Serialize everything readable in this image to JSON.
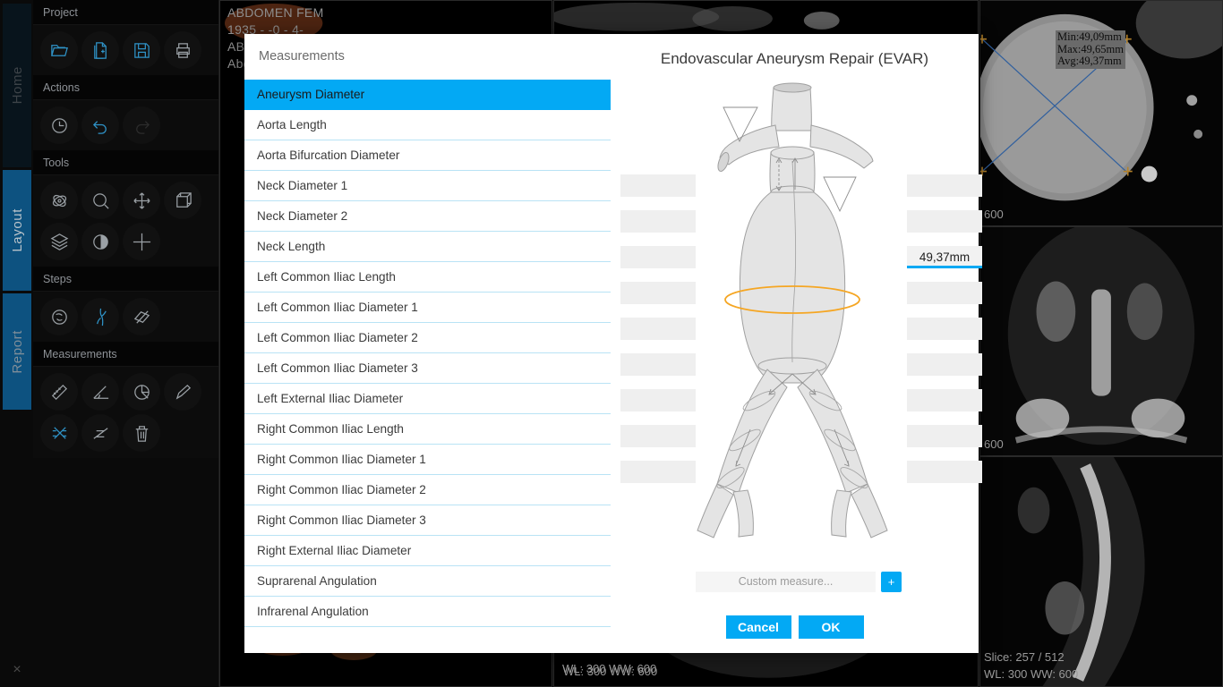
{
  "sidebar": {
    "vertical_tabs": [
      {
        "label": "Home",
        "active": false
      },
      {
        "label": "Layout",
        "active": true
      },
      {
        "label": "Report",
        "active": false
      }
    ],
    "close_icon": "×",
    "groups": [
      {
        "title": "Project",
        "tools": [
          "open-folder-icon",
          "new-document-icon",
          "save-icon",
          "print-icon"
        ]
      },
      {
        "title": "Actions",
        "tools": [
          "history-clock-icon",
          "undo-icon",
          "redo-icon"
        ]
      },
      {
        "title": "Tools",
        "tools": [
          "rotate-3d-icon",
          "zoom-magnifier-icon",
          "pan-move-icon",
          "crop-box-icon",
          "layers-icon",
          "contrast-icon",
          "crosshair-icon"
        ]
      },
      {
        "title": "Steps",
        "tools": [
          "centerline-seed-icon",
          "vessel-tree-icon",
          "slab-plane-icon"
        ]
      },
      {
        "title": "Measurements",
        "tools": [
          "ruler-icon",
          "angle-icon",
          "pie-area-icon",
          "pencil-icon",
          "cross-marker-icon",
          "polyline-icon",
          "trash-icon"
        ]
      }
    ]
  },
  "viewports": {
    "main": {
      "patient_name": "ABDOMEN FEM",
      "patient_id": "1935 - -0 - 4-",
      "study_line1": "ABD",
      "study_line2": "Abd",
      "wl_ww": "WL: 300  WW: 600"
    },
    "axial_top": {
      "wl_ww": "WL: 300  WW: 600"
    },
    "right_top": {
      "callout_min": "Min:49,09mm",
      "callout_max": "Max:49,65mm",
      "callout_avg": "Avg:49,37mm",
      "ww_partial": "600"
    },
    "right_mid": {
      "ww_partial": "600"
    },
    "right_bottom": {
      "slice": "Slice: 257 / 512",
      "wl_ww": "WL: 300  WW: 600"
    }
  },
  "modal": {
    "left_title": "Measurements",
    "title": "Endovascular Aneurysm Repair (EVAR)",
    "measurements": [
      {
        "label": "Aneurysm Diameter",
        "selected": true
      },
      {
        "label": "Aorta Length",
        "selected": false
      },
      {
        "label": "Aorta Bifurcation Diameter",
        "selected": false
      },
      {
        "label": "Neck Diameter 1",
        "selected": false
      },
      {
        "label": "Neck Diameter 2",
        "selected": false
      },
      {
        "label": "Neck Length",
        "selected": false
      },
      {
        "label": "Left Common Iliac Length",
        "selected": false
      },
      {
        "label": "Left Common Iliac Diameter 1",
        "selected": false
      },
      {
        "label": "Left Common Iliac Diameter 2",
        "selected": false
      },
      {
        "label": "Left Common Iliac Diameter 3",
        "selected": false
      },
      {
        "label": "Left External Iliac Diameter",
        "selected": false
      },
      {
        "label": "Right Common Iliac Length",
        "selected": false
      },
      {
        "label": "Right Common Iliac Diameter 1",
        "selected": false
      },
      {
        "label": "Right Common Iliac Diameter 2",
        "selected": false
      },
      {
        "label": "Right Common Iliac Diameter 3",
        "selected": false
      },
      {
        "label": "Right External Iliac Diameter",
        "selected": false
      },
      {
        "label": "Suprarenal Angulation",
        "selected": false
      },
      {
        "label": "Infrarenal Angulation",
        "selected": false
      }
    ],
    "fields_left": [
      "",
      "",
      "",
      "",
      "",
      "",
      "",
      "",
      ""
    ],
    "fields_right": [
      "",
      "",
      "49,37mm",
      "",
      "",
      "",
      "",
      "",
      ""
    ],
    "active_field_index": 2,
    "custom_measure_placeholder": "Custom measure...",
    "add_button_label": "+",
    "cancel_label": "Cancel",
    "ok_label": "OK"
  },
  "colors": {
    "accent": "#03a9f4",
    "highlight_ellipse": "#f5a623",
    "vessel_fill": "#e3e3e3",
    "vessel_stroke": "#9a9a9a"
  }
}
